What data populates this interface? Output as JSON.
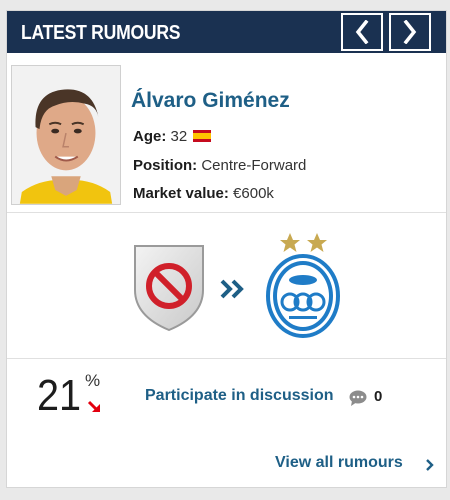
{
  "header": {
    "title": "LATEST RUMOURS"
  },
  "nav": {
    "prev_icon": "chevron-left",
    "next_icon": "chevron-right"
  },
  "player": {
    "name": "Álvaro Giménez",
    "age_label": "Age:",
    "age": "32",
    "nationality_flag": "spain-flag",
    "position_label": "Position:",
    "position": "Centre-Forward",
    "market_value_label": "Market value:",
    "market_value": "€600k"
  },
  "transfer": {
    "from_club_icon": "no-club-shield",
    "direction_icon": "double-chevron-right",
    "to_club_icon": "esteghlal-crest",
    "to_club_stars": 2
  },
  "stats": {
    "percent": "21",
    "percent_sign": "%",
    "trend_icon": "arrow-down-right",
    "discussion_link": "Participate in discussion",
    "comment_count": "0"
  },
  "footer": {
    "view_all": "View all rumours"
  },
  "colors": {
    "header_bg": "#1a3151",
    "link": "#1e5f86",
    "trend_down": "#e3000f",
    "club_blue": "#1f7cc7",
    "star_gold": "#c8a951"
  }
}
